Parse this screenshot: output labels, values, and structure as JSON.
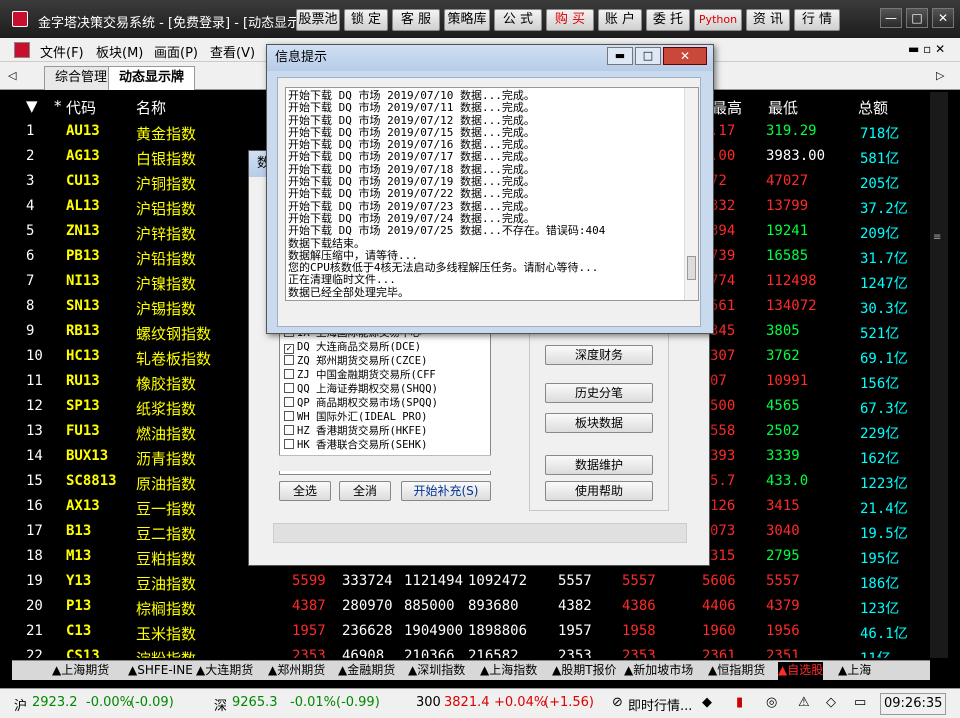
{
  "window": {
    "title": "金字塔决策交易系统 - [免费登录] - [动态显示"
  },
  "toolbar_buttons": [
    "股票池",
    "锁 定",
    "客 服",
    "策略库",
    "公 式",
    "购 买",
    "账 户",
    "委 托",
    "Python",
    "资 讯",
    "行 情"
  ],
  "menus": [
    "文件(F)",
    "板块(M)",
    "画面(P)",
    "查看(V)"
  ],
  "page_tabs": [
    "综合管理",
    "动态显示牌"
  ],
  "grid": {
    "headers": [
      "*",
      "代码",
      "名称",
      "最高",
      "最低",
      "总额"
    ],
    "rows": [
      {
        "n": "1",
        "code": "AU13",
        "name": "黄金指数",
        "hi": ".17",
        "lo": "319.29",
        "amt": "718亿"
      },
      {
        "n": "2",
        "code": "AG13",
        "name": "白银指数",
        "hi": ".00",
        "lo": "3983.00",
        "amt": "581亿"
      },
      {
        "n": "3",
        "code": "CU13",
        "name": "沪铜指数",
        "hi": "72",
        "lo": "47027",
        "amt": "205亿"
      },
      {
        "n": "4",
        "code": "AL13",
        "name": "沪铝指数",
        "hi": "332",
        "lo": "13799",
        "amt": "37.2亿"
      },
      {
        "n": "5",
        "code": "ZN13",
        "name": "沪锌指数",
        "hi": "394",
        "lo": "19241",
        "amt": "209亿"
      },
      {
        "n": "6",
        "code": "PB13",
        "name": "沪铅指数",
        "hi": "739",
        "lo": "16585",
        "amt": "31.7亿"
      },
      {
        "n": "7",
        "code": "NI13",
        "name": "沪镍指数",
        "hi": "774",
        "lo": "112498",
        "amt": "1247亿"
      },
      {
        "n": "8",
        "code": "SN13",
        "name": "沪锡指数",
        "hi": "561",
        "lo": "134072",
        "amt": "30.3亿"
      },
      {
        "n": "9",
        "code": "RB13",
        "name": "螺纹钢指数",
        "hi": "345",
        "lo": "3805",
        "amt": "521亿"
      },
      {
        "n": "10",
        "code": "HC13",
        "name": "轧卷板指数",
        "hi": "307",
        "lo": "3762",
        "amt": "69.1亿"
      },
      {
        "n": "11",
        "code": "RU13",
        "name": "橡胶指数",
        "hi": "07",
        "lo": "10991",
        "amt": "156亿"
      },
      {
        "n": "12",
        "code": "SP13",
        "name": "纸浆指数",
        "hi": "500",
        "lo": "4565",
        "amt": "67.3亿"
      },
      {
        "n": "13",
        "code": "FU13",
        "name": "燃油指数",
        "hi": "558",
        "lo": "2502",
        "amt": "229亿"
      },
      {
        "n": "14",
        "code": "BUX13",
        "name": "沥青指数",
        "hi": "393",
        "lo": "3339",
        "amt": "162亿"
      },
      {
        "n": "15",
        "code": "SC8813",
        "name": "原油指数",
        "hi": "5.7",
        "lo": "433.0",
        "amt": "1223亿"
      },
      {
        "n": "16",
        "code": "AX13",
        "name": "豆一指数",
        "hi": "126",
        "lo": "3415",
        "amt": "21.4亿"
      },
      {
        "n": "17",
        "code": "B13",
        "name": "豆二指数",
        "hi": "073",
        "lo": "3040",
        "amt": "19.5亿"
      },
      {
        "n": "18",
        "code": "M13",
        "name": "豆粕指数",
        "hi": "315",
        "lo": "2795",
        "amt": "195亿"
      },
      {
        "n": "19",
        "code": "Y13",
        "name": "豆油指数",
        "c1": "5599",
        "c2": "333724",
        "c3": "1121494",
        "c4": "1092472",
        "c5": "5557",
        "c6": "5557",
        "hi": "5606",
        "lo": "5557",
        "amt": "186亿"
      },
      {
        "n": "20",
        "code": "P13",
        "name": "棕榈指数",
        "c1": "4387",
        "c2": "280970",
        "c3": "885000",
        "c4": "893680",
        "c5": "4382",
        "c6": "4386",
        "hi": "4406",
        "lo": "4379",
        "amt": "123亿"
      },
      {
        "n": "21",
        "code": "C13",
        "name": "玉米指数",
        "c1": "1957",
        "c2": "236628",
        "c3": "1904900",
        "c4": "1898806",
        "c5": "1957",
        "c6": "1958",
        "hi": "1960",
        "lo": "1956",
        "amt": "46.1亿"
      },
      {
        "n": "22",
        "code": "CS13",
        "name": "淀粉指数",
        "c1": "2353",
        "c2": "46908",
        "c3": "210366",
        "c4": "216582",
        "c5": "2353",
        "c6": "2353",
        "hi": "2361",
        "lo": "2351",
        "amt": "11亿"
      }
    ]
  },
  "bottom_tabs": [
    "▲上海期货",
    "▲SHFE-INE",
    "▲大连期货",
    "▲郑州期货",
    "▲金融期货",
    "▲深圳指数",
    "▲上海指数",
    "▲股期T报价",
    "▲新加坡市场",
    "▲恒指期货",
    "▲自选股",
    "▲上海"
  ],
  "status": {
    "sh_label": "沪",
    "sh_val": "2923.2",
    "sh_chg": "-0.00%",
    "sh_pts": "(-0.09)",
    "sz_label": "深",
    "sz_val": "9265.3",
    "sz_chg": "-0.01%",
    "sz_pts": "(-0.99)",
    "i300_label": "300",
    "i300_val": "3821.4",
    "i300_chg": "+0.04%",
    "i300_pts": "(+1.56)",
    "ticker": "即时行情...",
    "time": "09:26:35"
  },
  "info_dialog": {
    "title": "信息提示",
    "log": [
      "开始下载 DQ 市场 2019/07/10 数据...完成。",
      "开始下载 DQ 市场 2019/07/11 数据...完成。",
      "开始下载 DQ 市场 2019/07/12 数据...完成。",
      "开始下载 DQ 市场 2019/07/15 数据...完成。",
      "开始下载 DQ 市场 2019/07/16 数据...完成。",
      "开始下载 DQ 市场 2019/07/17 数据...完成。",
      "开始下载 DQ 市场 2019/07/18 数据...完成。",
      "开始下载 DQ 市场 2019/07/19 数据...完成。",
      "开始下载 DQ 市场 2019/07/22 数据...完成。",
      "开始下载 DQ 市场 2019/07/23 数据...完成。",
      "开始下载 DQ 市场 2019/07/24 数据...完成。",
      "开始下载 DQ 市场 2019/07/25 数据...不存在。错误码:404",
      "数据下载结束。",
      "数据解压缩中，请等待...",
      "您的CPU核数低于4核无法启动多线程解压任务。请耐心等待...",
      "正在清理临时文件...",
      "数据已经全部处理完毕。"
    ]
  },
  "data_dialog": {
    "title": "数",
    "exchanges": [
      {
        "checked": false,
        "text": "IX 上海国际能源交易中心"
      },
      {
        "checked": true,
        "text": "DQ 大连商品交易所(DCE)"
      },
      {
        "checked": false,
        "text": "ZQ 郑州期货交易所(CZCE)"
      },
      {
        "checked": false,
        "text": "ZJ 中国金融期货交易所(CFF"
      },
      {
        "checked": false,
        "text": "QQ 上海证券期权交易(SHQQ)"
      },
      {
        "checked": false,
        "text": "QP 商品期权交易市场(SPQQ)"
      },
      {
        "checked": false,
        "text": "WH 国际外汇(IDEAL PRO)"
      },
      {
        "checked": false,
        "text": "HZ 香港期货交易所(HKFE)"
      },
      {
        "checked": false,
        "text": "HK 香港联合交易所(SEHK)"
      }
    ],
    "btn_select_all": "全选",
    "btn_clear_all": "全消",
    "btn_start": "开始补充(S)",
    "btn_deep_finance": "深度财务",
    "btn_history_split": "历史分笔",
    "btn_block_data": "板块数据",
    "btn_maintain": "数据维护",
    "btn_help": "使用帮助"
  }
}
